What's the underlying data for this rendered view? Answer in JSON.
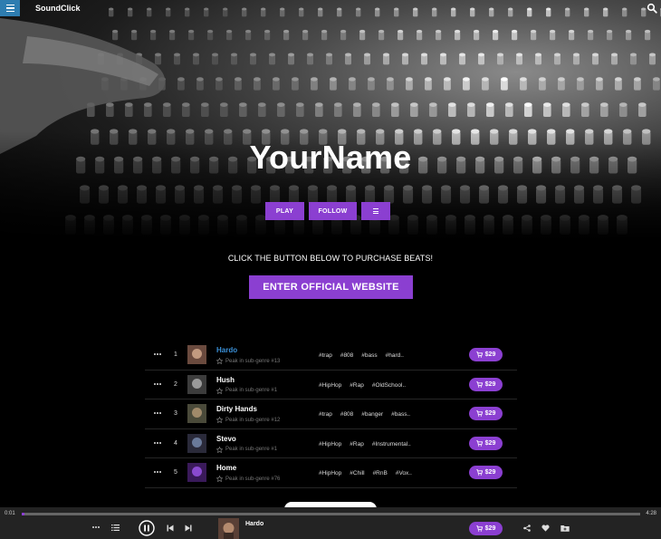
{
  "header": {
    "brand": "SoundClick",
    "menu_icon": "hamburger-menu-icon",
    "search_icon": "search-icon"
  },
  "hero": {
    "artist_name": "YourName",
    "play_label": "PLAY",
    "follow_label": "FOLLOW",
    "more_icon": "bars-menu-icon"
  },
  "promo": {
    "text": "CLICK THE BUTTON BELOW TO PURCHASE BEATS!",
    "button_label": "ENTER OFFICIAL WEBSITE"
  },
  "tracks": [
    {
      "num": "1",
      "title": "Hardo",
      "peak": "Peak in sub-genre #13",
      "tags": [
        "#trap",
        "#808",
        "#bass",
        "#hard.."
      ],
      "price": "$29",
      "active": true
    },
    {
      "num": "2",
      "title": "Hush",
      "peak": "Peak in sub-genre #1",
      "tags": [
        "#HipHop",
        "#Rap",
        "#OldSchool.."
      ],
      "price": "$29",
      "active": false
    },
    {
      "num": "3",
      "title": "Dirty Hands",
      "peak": "Peak in sub-genre #12",
      "tags": [
        "#trap",
        "#808",
        "#banger",
        "#bass.."
      ],
      "price": "$29",
      "active": false
    },
    {
      "num": "4",
      "title": "Stevo",
      "peak": "Peak in sub-genre #1",
      "tags": [
        "#HipHop",
        "#Rap",
        "#Instrumental.."
      ],
      "price": "$29",
      "active": false
    },
    {
      "num": "5",
      "title": "Home",
      "peak": "Peak in sub-genre #76",
      "tags": [
        "#HipHop",
        "#Chill",
        "#RnB",
        "#Vox.."
      ],
      "price": "$29",
      "active": false
    }
  ],
  "player": {
    "current_time": "0:01",
    "total_time": "4:28",
    "progress_fraction": 0.004,
    "now_playing": "Hardo",
    "price": "$29"
  },
  "colors": {
    "accent": "#8b3fd1",
    "active_title": "#3a8fd6",
    "menu_button": "#2e7db0",
    "player_bg": "#232323"
  }
}
